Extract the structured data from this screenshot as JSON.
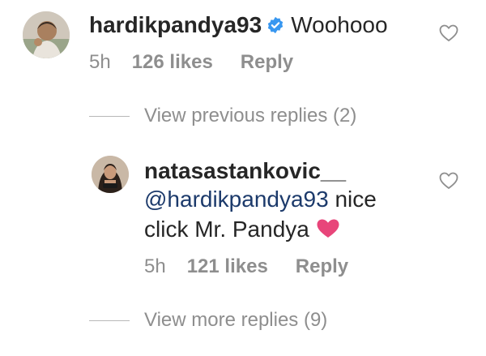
{
  "comment": {
    "avatar_icon": "avatar-hardikpandya93",
    "username": "hardikpandya93",
    "verified_icon": "verified-badge-icon",
    "verified_color": "#3897f0",
    "text": "Woohooo",
    "time": "5h",
    "likes": "126 likes",
    "reply_label": "Reply",
    "like_icon": "heart-outline-icon"
  },
  "view_previous": {
    "label": "View previous replies (2)"
  },
  "reply": {
    "avatar_icon": "avatar-natasastankovic",
    "username": "natasastankovic__",
    "mention": "@hardikpandya93",
    "text_part1": " nice",
    "text_part2": "click Mr. Pandya",
    "emoji_icon": "pink-heart-emoji",
    "emoji_color": "#e8457a",
    "time": "5h",
    "likes": "121 likes",
    "reply_label": "Reply",
    "like_icon": "heart-outline-icon"
  },
  "view_more": {
    "label": "View more replies (9)"
  },
  "colors": {
    "text": "#262626",
    "meta": "#8e8e8e",
    "mention": "#1c3a6b"
  }
}
